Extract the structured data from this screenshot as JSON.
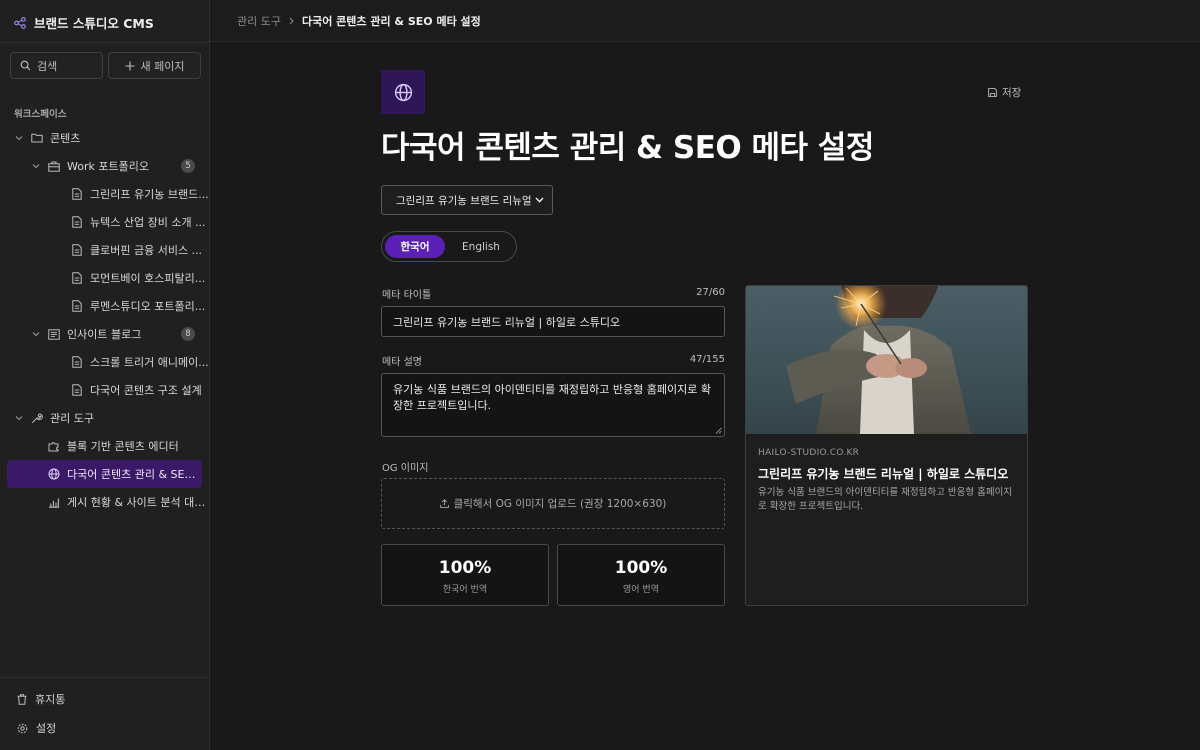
{
  "brand": {
    "name": "브랜드 스튜디오 CMS"
  },
  "sidebar": {
    "search_label": "검색",
    "new_page_label": "새 페이지",
    "workspace_label": "워크스페이스",
    "tree": {
      "contents": {
        "label": "콘텐츠",
        "portfolio": {
          "label": "Work 포트폴리오",
          "count": "5",
          "items": [
            "그린리프 유기농 브랜드...",
            "뉴텍스 산업 장비 소개 ...",
            "클로버핀 금융 서비스 ...",
            "모먼트베이 호스피탈리...",
            "루멘스튜디오 포트폴리..."
          ]
        },
        "blog": {
          "label": "인사이트 블로그",
          "count": "8",
          "items": [
            "스크롤 트리거 애니메이...",
            "다국어 콘텐츠 구조 설계"
          ]
        }
      },
      "admin": {
        "label": "관리 도구",
        "items": [
          "블록 기반 콘텐츠 에디터",
          "다국어 콘텐츠 관리 & SEO ...",
          "게시 현황 & 사이트 분석 대시..."
        ]
      }
    },
    "trash_label": "휴지통",
    "settings_label": "설정"
  },
  "breadcrumb": {
    "parent": "관리 도구",
    "current": "다국어 콘텐츠 관리 & SEO 메타 설정"
  },
  "toolbar": {
    "save_label": "저장"
  },
  "page": {
    "title": "다국어 콘텐츠 관리 & SEO 메타 설정",
    "selected_page": "그린리프 유기농 브랜드 리뉴얼",
    "languages": [
      "한국어",
      "English"
    ],
    "active_language": "한국어"
  },
  "form": {
    "meta_title_label": "메타 타이틀",
    "meta_title_count": "27/60",
    "meta_title_value": "그린리프 유기농 브랜드 리뉴얼 | 하일로 스튜디오",
    "meta_desc_label": "메타 설명",
    "meta_desc_count": "47/155",
    "meta_desc_value": "유기농 식품 브랜드의 아이덴티티를 재정립하고 반응형 홈페이지로 확장한 프로젝트입니다.",
    "og_label": "OG 이미지",
    "og_upload_text": "클릭해서 OG 이미지 업로드 (권장 1200×630)"
  },
  "stats": [
    {
      "value": "100%",
      "label": "한국어 번역"
    },
    {
      "value": "100%",
      "label": "영어 번역"
    }
  ],
  "preview": {
    "domain": "HAILO-STUDIO.CO.KR",
    "title": "그린리프 유기농 브랜드 리뉴얼 | 하일로 스튜디오",
    "description": "유기농 식품 브랜드의 아이덴티티를 재정립하고 반응형 홈페이지로 확장한 프로젝트입니다."
  },
  "colors": {
    "accent": "#5b21b6",
    "active_bg": "#3a1a66",
    "background": "#191919",
    "sidebar_bg": "#202020"
  }
}
